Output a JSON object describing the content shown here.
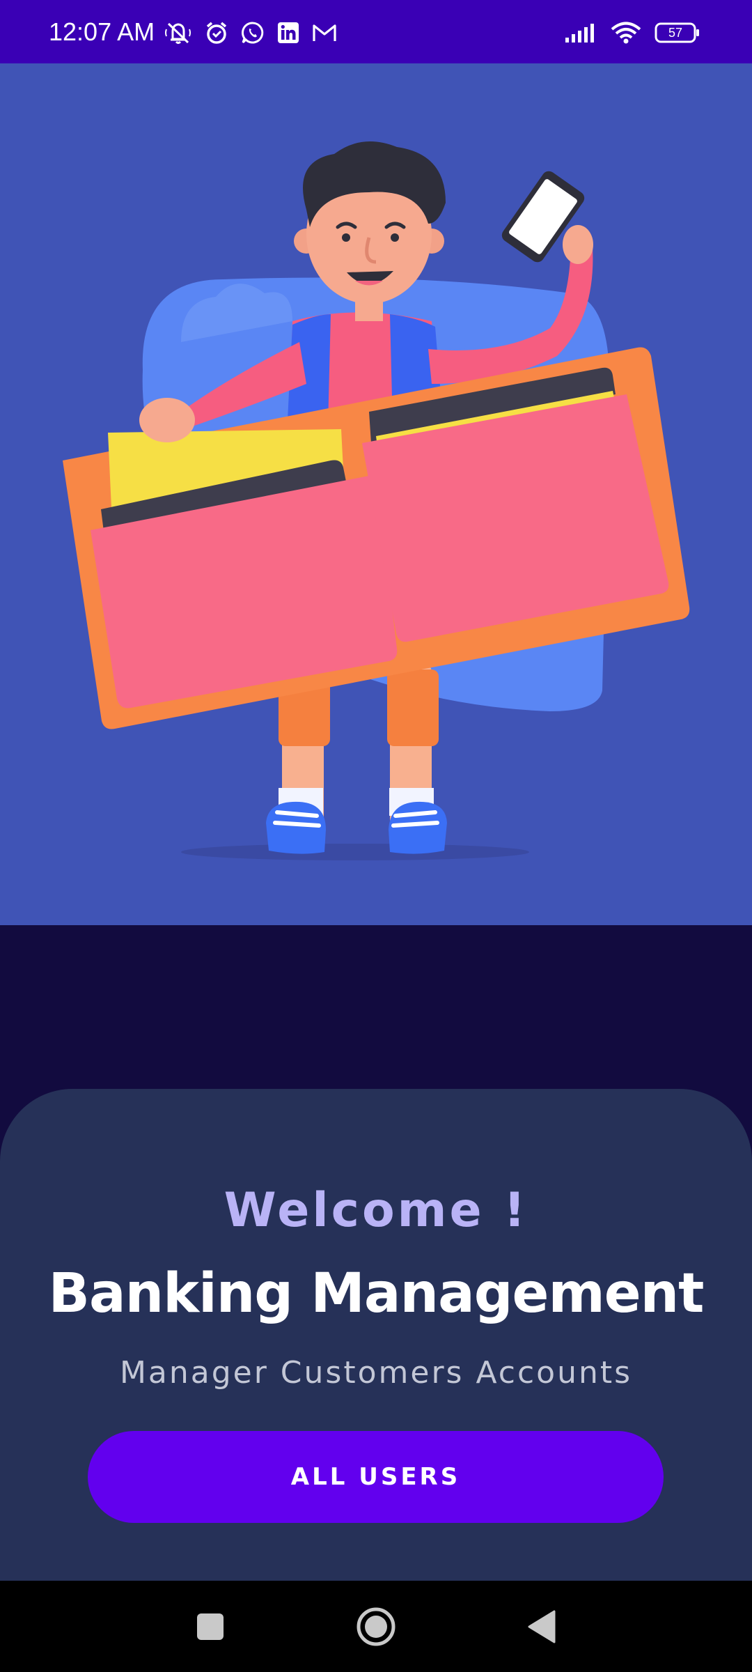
{
  "status_bar": {
    "time": "12:07 AM",
    "battery_level": "57",
    "left_icons": [
      "mute-icon",
      "alarm-icon",
      "whatsapp-icon",
      "linkedin-icon",
      "gmail-icon"
    ],
    "right_icons": [
      "signal-icon",
      "wifi-icon",
      "battery-icon"
    ]
  },
  "hero": {
    "illustration": "person-holding-wallet-illustration",
    "colors": {
      "background": "#4054b6",
      "blob": "#5a86f4",
      "wallet_frame": "#f88746",
      "wallet_pocket": "#f86a87",
      "card_yellow": "#f6df45",
      "card_dark": "#3e3d4d"
    }
  },
  "welcome": {
    "greeting": "Welcome !",
    "title": "Banking Management",
    "subtitle": "Manager Customers Accounts",
    "button_label": "ALL USERS"
  },
  "colors": {
    "status_bar": "#3a00b5",
    "page_background": "#120b3f",
    "card_background": "#263158",
    "accent": "#6200ee",
    "greeting": "#b9b3f6"
  },
  "nav_bar": {
    "buttons": [
      "recents-icon",
      "home-icon",
      "back-icon"
    ]
  }
}
